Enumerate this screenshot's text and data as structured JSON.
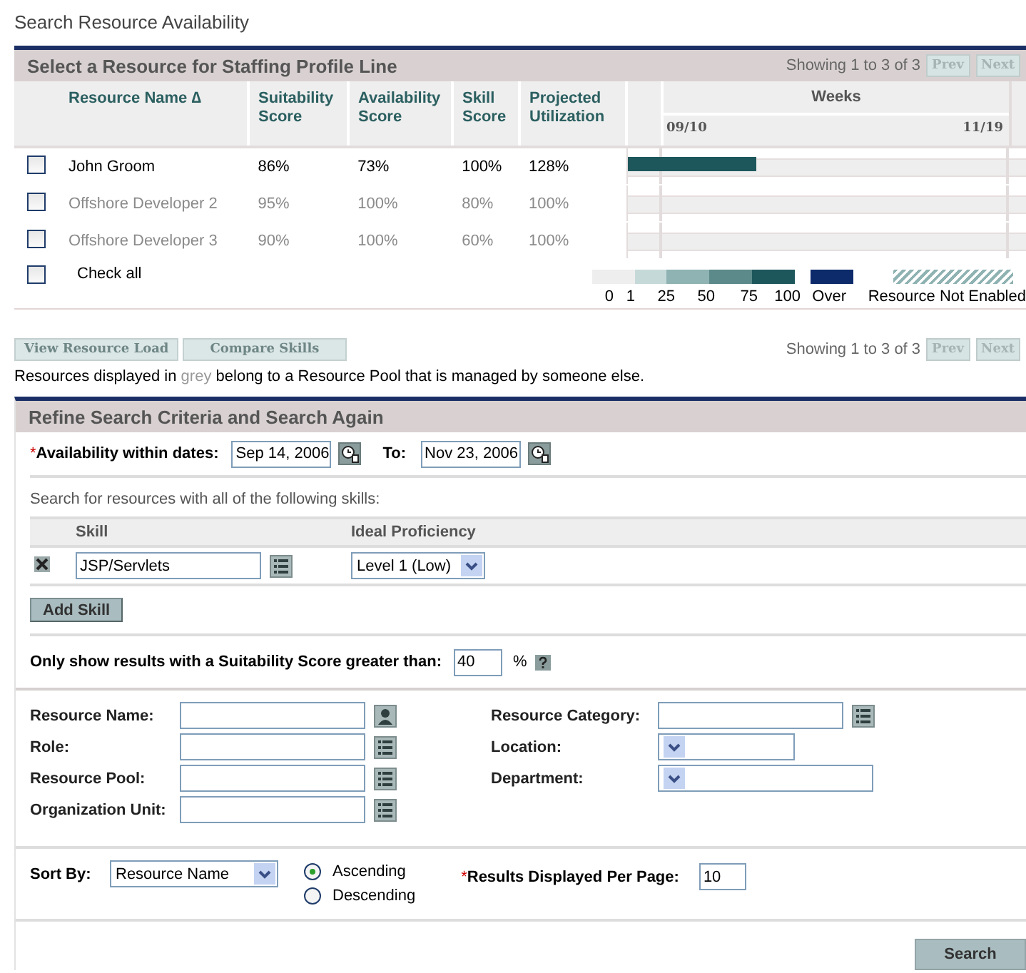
{
  "page_title": "Search Resource Availability",
  "results": {
    "title": "Select a Resource for Staffing Profile Line",
    "paging_top": {
      "text": "Showing 1 to 3 of 3",
      "prev": "Prev",
      "next": "Next"
    },
    "columns": [
      "Resource Name ∆",
      "Suitability Score",
      "Availability Score",
      "Skill Score",
      "Projected Utilization"
    ],
    "weeks": {
      "label": "Weeks",
      "start": "09/10",
      "end": "11/19"
    },
    "rows": [
      {
        "name": "John Groom",
        "suitability": "86%",
        "availability": "73%",
        "skill": "100%",
        "utilization": "128%",
        "checked": false,
        "external": false,
        "load_bar": true
      },
      {
        "name": "Offshore Developer 2",
        "suitability": "95%",
        "availability": "100%",
        "skill": "80%",
        "utilization": "100%",
        "checked": false,
        "external": true,
        "load_bar": false
      },
      {
        "name": "Offshore Developer 3",
        "suitability": "90%",
        "availability": "100%",
        "skill": "60%",
        "utilization": "100%",
        "checked": false,
        "external": true,
        "load_bar": false
      }
    ],
    "check_all": {
      "label": "Check all",
      "checked": false
    },
    "legend": {
      "swatches": [
        {
          "kind": "solid",
          "color": "#eeeeee"
        },
        {
          "kind": "solid",
          "color": "#c6d9d9"
        },
        {
          "kind": "solid",
          "color": "#8fb2b2"
        },
        {
          "kind": "solid",
          "color": "#5c8a8a"
        },
        {
          "kind": "solid",
          "color": "#1d575b"
        },
        {
          "kind": "solid",
          "color": "#0d2b6b"
        },
        {
          "kind": "hatched",
          "color": "#8fb2b2"
        }
      ],
      "labels": [
        "0",
        "1",
        "25",
        "50",
        "75",
        "100",
        "Over",
        "Resource Not Enabled"
      ]
    },
    "buttons": [
      {
        "label": "View Resource Load",
        "disabled": true
      },
      {
        "label": "Compare Skills",
        "disabled": true
      }
    ],
    "paging_bottom": {
      "text": "Showing 1 to 3 of 3",
      "prev": "Prev",
      "next": "Next"
    },
    "note": {
      "before": "Resources displayed in",
      "highlight": "grey",
      "after": "belong to a Resource Pool that is managed by someone else."
    }
  },
  "refine": {
    "title": "Refine Search Criteria and Search Again",
    "availability": {
      "required_mark": "*",
      "label": "Availability within dates:",
      "from": "Sep 14, 2006",
      "to_label": "To:",
      "to": "Nov 23, 2006"
    },
    "skills_intro": "Search for resources with all of the following skills:",
    "skills_table": {
      "columns": [
        "Skill",
        "Ideal Proficiency"
      ],
      "rows": [
        {
          "skill": "JSP/Servlets",
          "proficiency": "Level 1 (Low)"
        }
      ]
    },
    "add_skill": "Add Skill",
    "suitability_filter": {
      "label": "Only show results with a Suitability Score greater than:",
      "value": "40",
      "unit": "%"
    },
    "fields_left": [
      {
        "label": "Resource Name:",
        "kind": "person-lookup"
      },
      {
        "label": "Role:",
        "kind": "list-lookup"
      },
      {
        "label": "Resource Pool:",
        "kind": "list-lookup"
      },
      {
        "label": "Organization Unit:",
        "kind": "list-lookup"
      }
    ],
    "fields_right": [
      {
        "label": "Resource Category:",
        "kind": "list-lookup"
      },
      {
        "label": "Location:",
        "kind": "dropdown"
      },
      {
        "label": "Department:",
        "kind": "dropdown-wide"
      }
    ],
    "sort": {
      "label": "Sort By:",
      "value": "Resource Name",
      "options": [
        {
          "label": "Ascending",
          "selected": true
        },
        {
          "label": "Descending",
          "selected": false
        }
      ]
    },
    "per_page": {
      "required_mark": "*",
      "label": "Results Displayed Per Page:",
      "value": "10"
    },
    "search": "Search"
  }
}
